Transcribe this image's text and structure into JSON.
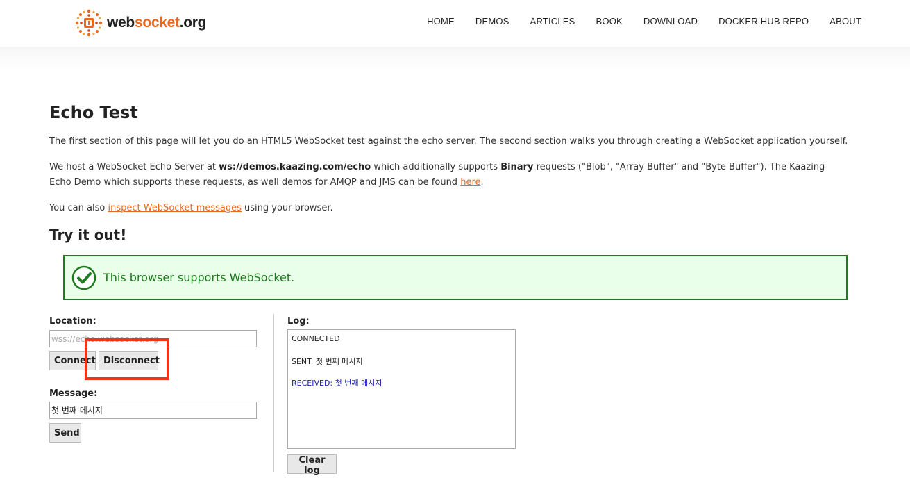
{
  "header": {
    "logo_icon": "websocket-logo-icon",
    "logo_text_main": "web",
    "logo_text_accent": "socket",
    "logo_text_tail": ".org",
    "nav": [
      {
        "label": "HOME"
      },
      {
        "label": "DEMOS"
      },
      {
        "label": "ARTICLES"
      },
      {
        "label": "BOOK"
      },
      {
        "label": "DOWNLOAD"
      },
      {
        "label": "DOCKER HUB REPO"
      },
      {
        "label": "ABOUT"
      }
    ]
  },
  "main": {
    "title": "Echo Test",
    "intro": "The first section of this page will let you do an HTML5 WebSocket test against the echo server. The second section walks you through creating a WebSocket application yourself.",
    "host_pre": "We host a WebSocket Echo Server at ",
    "host_url": "ws://demos.kaazing.com/echo",
    "host_mid": " which additionally supports ",
    "host_binary": "Binary",
    "host_post": " requests (\"Blob\", \"Array Buffer\" and \"Byte Buffer\"). The Kaazing Echo Demo which supports these requests, as well demos for AMQP and JMS can be found ",
    "host_link": "here",
    "host_end": ".",
    "inspect_pre": "You can also ",
    "inspect_link": "inspect WebSocket messages",
    "inspect_post": " using your browser.",
    "try_title": "Try it out!",
    "support_message": "This browser supports WebSocket.",
    "support_icon": "check-circle-icon"
  },
  "form": {
    "location_label": "Location:",
    "location_placeholder": "wss://echo.websocket.org",
    "connect_label": "Connect",
    "disconnect_label": "Disconnect",
    "message_label": "Message:",
    "message_value": "첫 번째 메시지",
    "send_label": "Send"
  },
  "log": {
    "label": "Log:",
    "lines": [
      {
        "text": "CONNECTED"
      },
      {
        "text": "SENT: 첫 번째 메시지"
      },
      {
        "text": "RECEIVED: 첫 번째 메시지"
      }
    ],
    "clear_label": "Clear log"
  },
  "colors": {
    "accent": "#e8681f",
    "success": "#1a7a1a",
    "received": "#1a1ab8",
    "highlight": "#f2331a"
  }
}
